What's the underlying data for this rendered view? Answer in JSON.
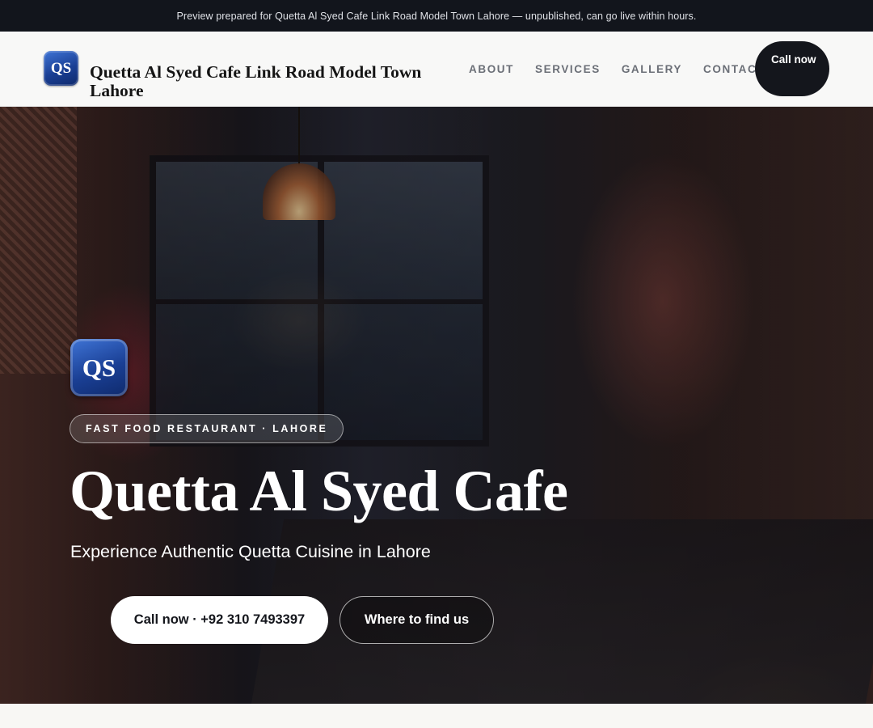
{
  "preview_bar": {
    "text": "Preview prepared for Quetta Al Syed Cafe Link Road Model Town Lahore — unpublished, can go live within hours."
  },
  "header": {
    "logo_initials": "QS",
    "brand_name": "Quetta Al Syed Cafe Link Road Model Town Lahore",
    "nav": [
      {
        "label": "ABOUT"
      },
      {
        "label": "SERVICES"
      },
      {
        "label": "GALLERY"
      },
      {
        "label": "CONTACT"
      }
    ],
    "call_button": "Call now"
  },
  "hero": {
    "badge_initials": "QS",
    "kicker": "FAST FOOD RESTAURANT · LAHORE",
    "title": "Quetta Al Syed Cafe",
    "subtitle": "Experience Authentic Quetta Cuisine in Lahore",
    "primary_button": "Call now · +92 310 7493397",
    "secondary_button": "Where to find us"
  },
  "colors": {
    "preview_bar_bg": "#12151c",
    "header_bg": "#f8f8f7",
    "call_button_bg": "#14161c",
    "logo_blue": "#1a3f94"
  }
}
